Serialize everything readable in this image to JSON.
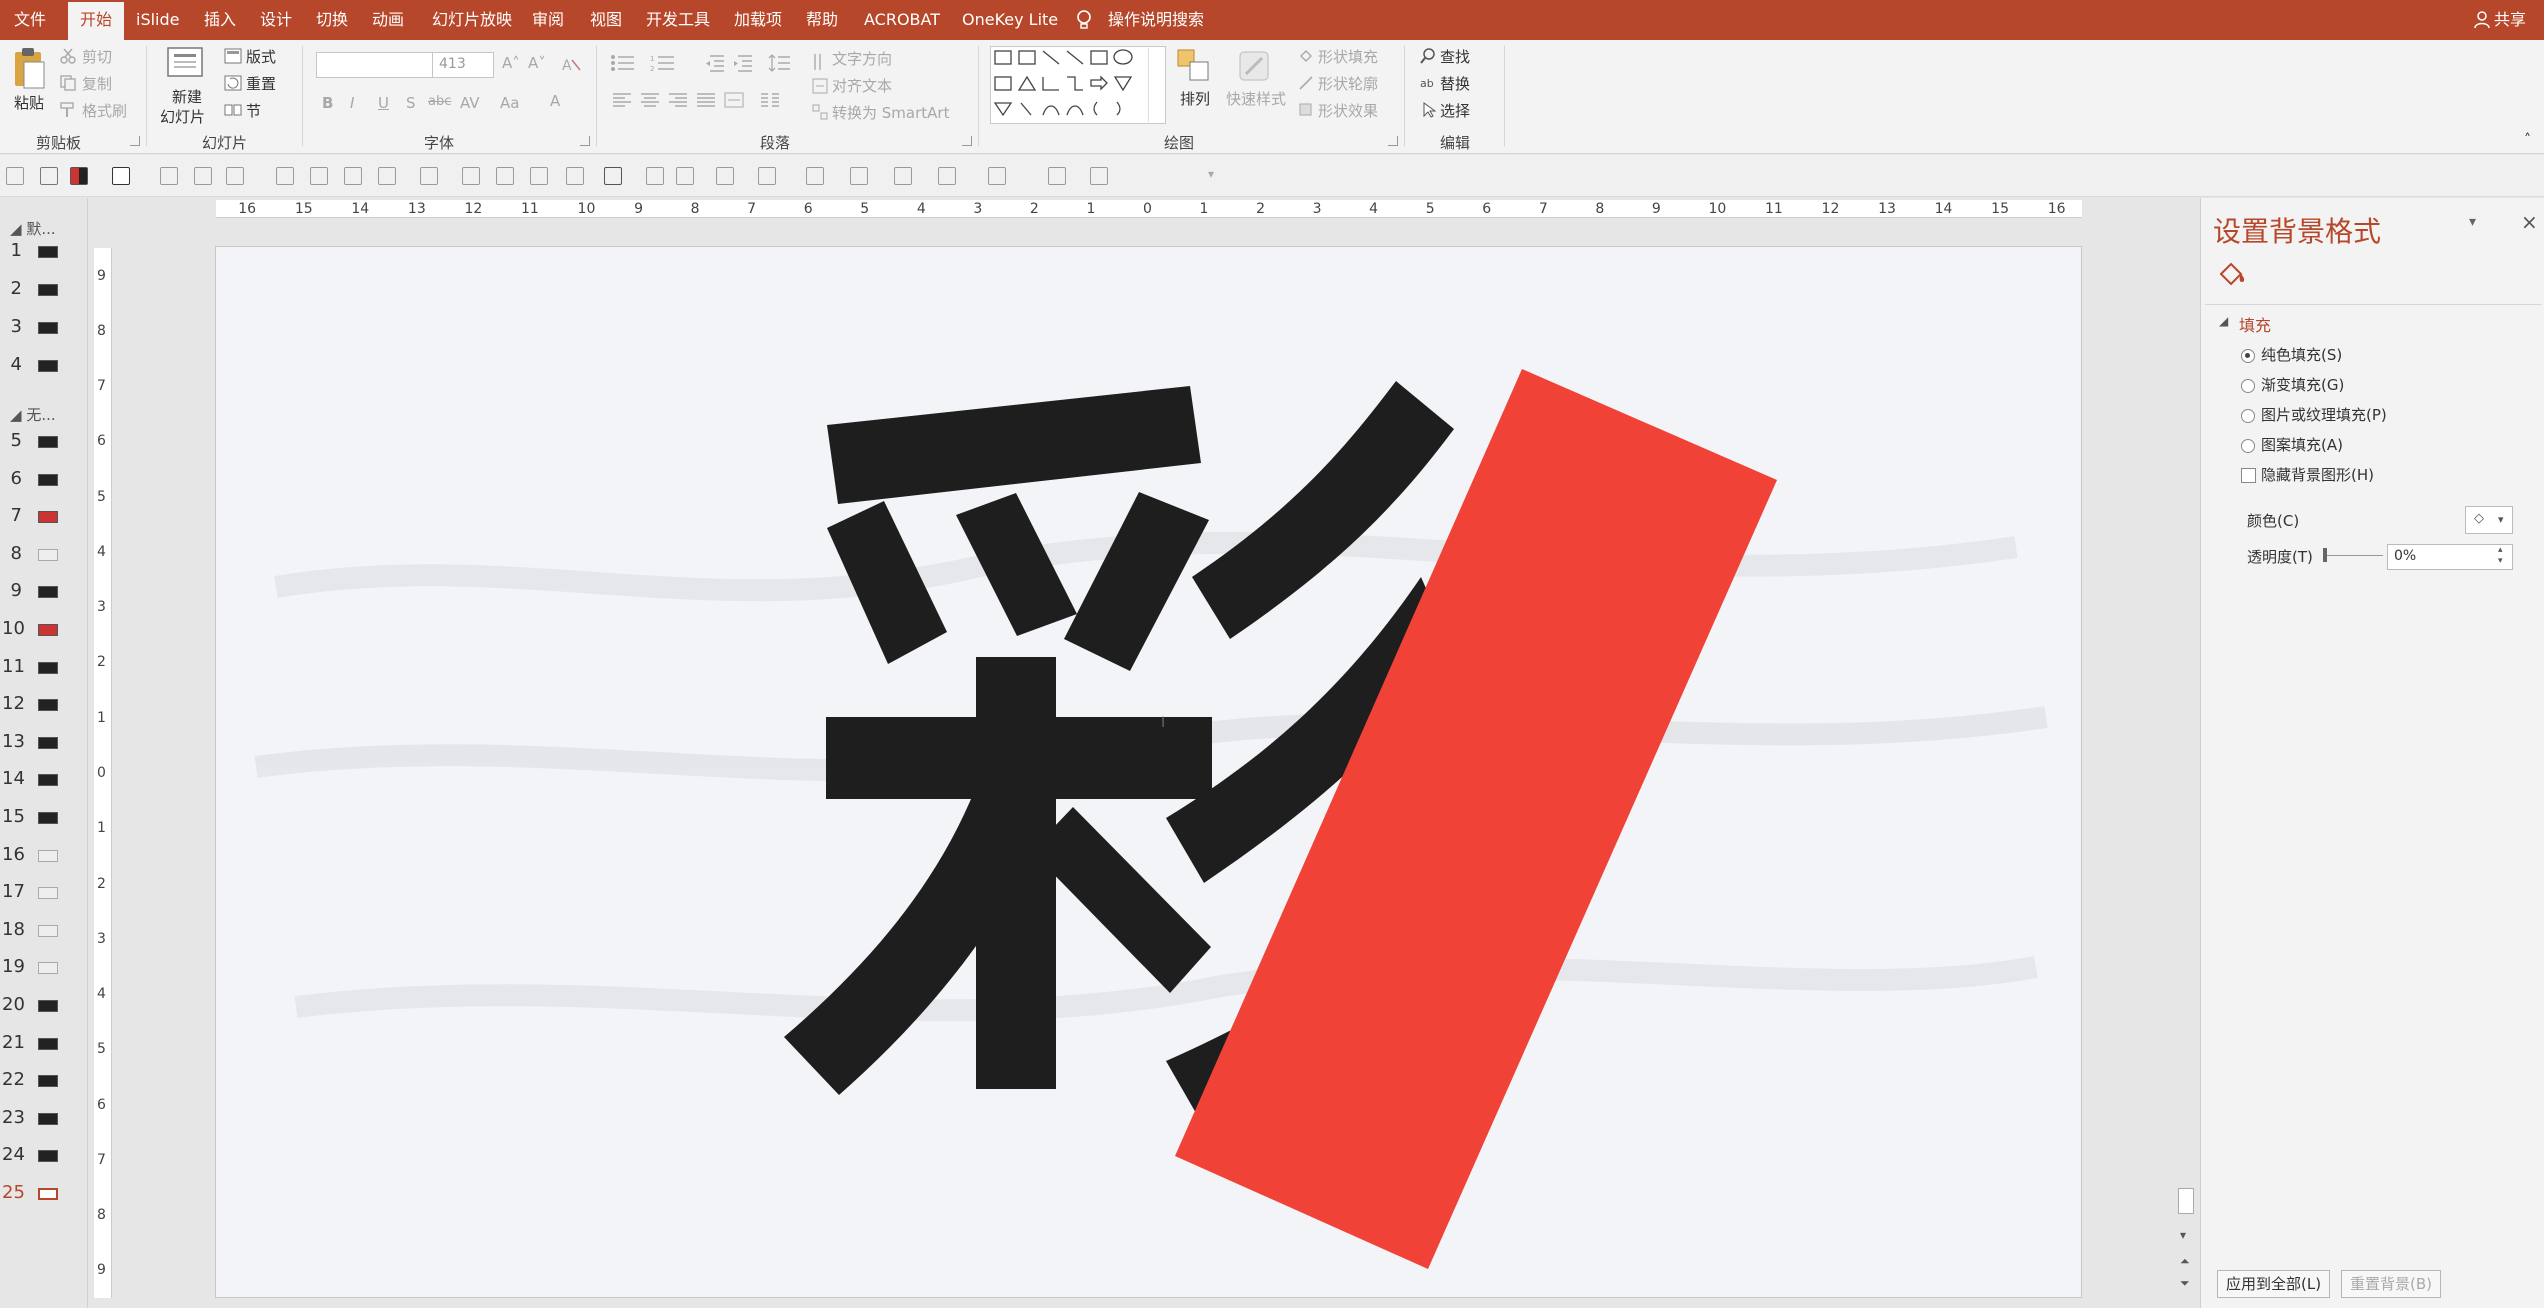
{
  "menu": {
    "tabs": [
      "文件",
      "开始",
      "iSlide",
      "插入",
      "设计",
      "切换",
      "动画",
      "幻灯片放映",
      "审阅",
      "视图",
      "开发工具",
      "加载项",
      "帮助",
      "ACROBAT",
      "OneKey Lite"
    ],
    "search": "操作说明搜索",
    "share": "共享"
  },
  "ribbon": {
    "clipboard": {
      "paste": "粘贴",
      "cut": "剪切",
      "copy": "复制",
      "format_painter": "格式刷",
      "label": "剪贴板"
    },
    "slides": {
      "new_slide_1": "新建",
      "new_slide_2": "幻灯片",
      "layout": "版式",
      "reset": "重置",
      "section": "节",
      "label": "幻灯片"
    },
    "font": {
      "size": "413",
      "label": "字体",
      "bold": "B",
      "italic": "I",
      "underline": "U",
      "shadow": "S",
      "strike": "abc",
      "spacing": "AV",
      "case": "Aa",
      "color": "A"
    },
    "paragraph": {
      "text_direction": "文字方向",
      "align_text": "对齐文本",
      "smartart": "转换为 SmartArt",
      "label": "段落"
    },
    "drawing": {
      "arrange": "排列",
      "quick_styles": "快速样式",
      "shape_fill": "形状填充",
      "shape_outline": "形状轮廓",
      "shape_effects": "形状效果",
      "label": "绘图"
    },
    "editing": {
      "find": "查找",
      "replace": "替换",
      "select": "选择",
      "label": "编辑"
    }
  },
  "thumbnails": {
    "sections": [
      {
        "label": "默..."
      },
      {
        "label": "无..."
      }
    ],
    "slides": [
      {
        "n": "1",
        "style": "dark"
      },
      {
        "n": "2",
        "style": "dark"
      },
      {
        "n": "3",
        "style": "dark"
      },
      {
        "n": "4",
        "style": "dark"
      },
      {
        "n": "5",
        "style": "dark"
      },
      {
        "n": "6",
        "style": "dark"
      },
      {
        "n": "7",
        "style": "red"
      },
      {
        "n": "8",
        "style": "light"
      },
      {
        "n": "9",
        "style": "dark"
      },
      {
        "n": "10",
        "style": "red"
      },
      {
        "n": "11",
        "style": "dark"
      },
      {
        "n": "12",
        "style": "dark"
      },
      {
        "n": "13",
        "style": "dark"
      },
      {
        "n": "14",
        "style": "dark"
      },
      {
        "n": "15",
        "style": "dark"
      },
      {
        "n": "16",
        "style": "light"
      },
      {
        "n": "17",
        "style": "light"
      },
      {
        "n": "18",
        "style": "light"
      },
      {
        "n": "19",
        "style": "light"
      },
      {
        "n": "20",
        "style": "dark"
      },
      {
        "n": "21",
        "style": "dark"
      },
      {
        "n": "22",
        "style": "dark"
      },
      {
        "n": "23",
        "style": "dark"
      },
      {
        "n": "24",
        "style": "dark"
      },
      {
        "n": "25",
        "style": "selected"
      }
    ]
  },
  "ruler": {
    "h_labels": [
      "16",
      "15",
      "14",
      "13",
      "12",
      "11",
      "10",
      "9",
      "8",
      "7",
      "6",
      "5",
      "4",
      "3",
      "2",
      "1",
      "0",
      "1",
      "2",
      "3",
      "4",
      "5",
      "6",
      "7",
      "8",
      "9",
      "10",
      "11",
      "12",
      "13",
      "14",
      "15",
      "16"
    ],
    "v_labels": [
      "9",
      "8",
      "7",
      "6",
      "5",
      "4",
      "3",
      "2",
      "1",
      "0",
      "1",
      "2",
      "3",
      "4",
      "5",
      "6",
      "7",
      "8",
      "9"
    ]
  },
  "slide": {
    "character": "彩",
    "colors": {
      "background": "#f2f4f7",
      "glyph": "#1e1e1e",
      "accent": "#f04237"
    }
  },
  "format_pane": {
    "title": "设置背景格式",
    "section": "填充",
    "options": [
      "纯色填充(S)",
      "渐变填充(G)",
      "图片或纹理填充(P)",
      "图案填充(A)"
    ],
    "selected_option": "纯色填充(S)",
    "hide_graphics": "隐藏背景图形(H)",
    "color_label": "颜色(C)",
    "transparency_label": "透明度(T)",
    "transparency_value": "0%",
    "apply_all": "应用到全部(L)",
    "reset_bg": "重置背景(B)"
  },
  "colors": {
    "brand": "#b7472a"
  }
}
